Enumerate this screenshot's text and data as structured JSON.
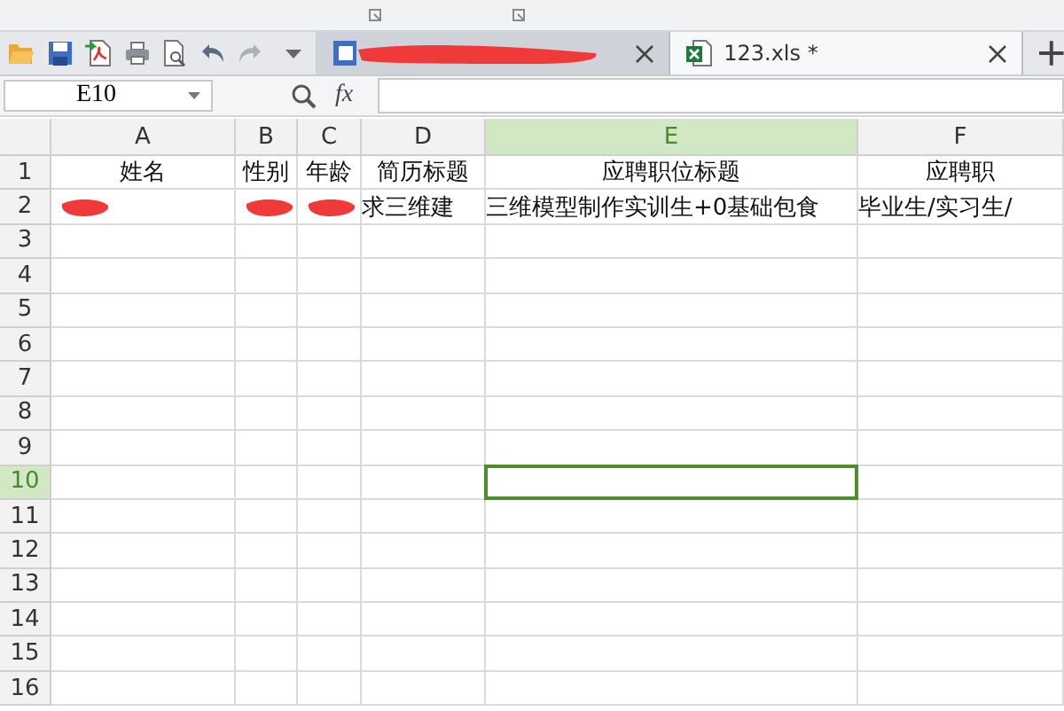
{
  "tabs": [
    {
      "title_redacted": true,
      "kind": "doc",
      "selected": false
    },
    {
      "title": "123.xls *",
      "kind": "sheet",
      "selected": true
    }
  ],
  "name_box": {
    "value": "E10"
  },
  "formula_bar": {
    "fx_label": "fx"
  },
  "columns": [
    {
      "label": "A",
      "selected": false
    },
    {
      "label": "B",
      "selected": false
    },
    {
      "label": "C",
      "selected": false
    },
    {
      "label": "D",
      "selected": false
    },
    {
      "label": "E",
      "selected": true
    },
    {
      "label": "F",
      "selected": false
    }
  ],
  "rows": [
    {
      "number": "1",
      "selected": false,
      "cells": [
        {
          "text": "姓名"
        },
        {
          "text": "性别"
        },
        {
          "text": "年龄"
        },
        {
          "text": "简历标题"
        },
        {
          "text": "应聘职位标题"
        },
        {
          "text": "应聘职"
        }
      ]
    },
    {
      "number": "2",
      "selected": false,
      "cells": [
        {
          "redacted": true
        },
        {
          "redacted": true
        },
        {
          "redacted": true
        },
        {
          "text": "求三维建"
        },
        {
          "text": "三维模型制作实训生+0基础包食"
        },
        {
          "text": "毕业生/实习生/"
        }
      ]
    },
    {
      "number": "3",
      "selected": false,
      "cells": []
    },
    {
      "number": "4",
      "selected": false,
      "cells": []
    },
    {
      "number": "5",
      "selected": false,
      "cells": []
    },
    {
      "number": "6",
      "selected": false,
      "cells": []
    },
    {
      "number": "7",
      "selected": false,
      "cells": []
    },
    {
      "number": "8",
      "selected": false,
      "cells": []
    },
    {
      "number": "9",
      "selected": false,
      "cells": []
    },
    {
      "number": "10",
      "selected": true,
      "cells": []
    },
    {
      "number": "11",
      "selected": false,
      "cells": []
    },
    {
      "number": "12",
      "selected": false,
      "cells": []
    },
    {
      "number": "13",
      "selected": false,
      "cells": []
    },
    {
      "number": "14",
      "selected": false,
      "cells": []
    },
    {
      "number": "15",
      "selected": false,
      "cells": []
    },
    {
      "number": "16",
      "selected": false,
      "cells": []
    }
  ]
}
